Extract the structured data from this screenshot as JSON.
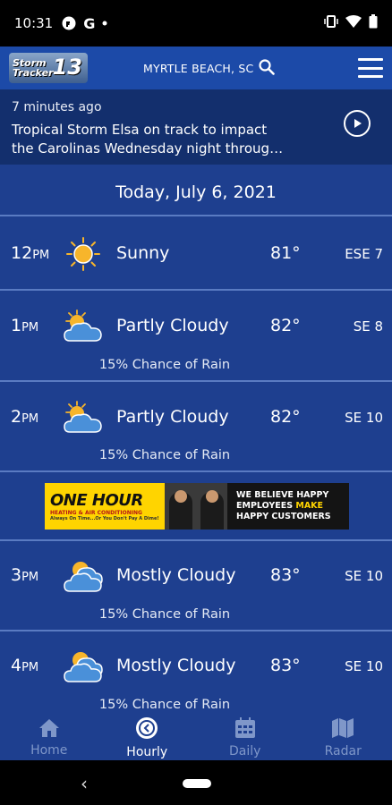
{
  "status_bar": {
    "time": "10:31",
    "icons": [
      "facebook-messenger-icon",
      "google-icon",
      "dot-icon",
      "vibrate-icon",
      "wifi-icon",
      "battery-icon"
    ]
  },
  "header": {
    "logo_text_line1": "Storm",
    "logo_text_line2": "Tracker",
    "logo_number": "13",
    "location": "MYRTLE BEACH, SC"
  },
  "news": {
    "ago": "7 minutes ago",
    "headline_line1": "Tropical Storm Elsa on track to impact",
    "headline_line2": "the Carolinas Wednesday night throug…"
  },
  "date_heading": "Today, July 6, 2021",
  "hours": [
    {
      "hour": "12",
      "ampm": "PM",
      "icon": "sunny-icon",
      "condition": "Sunny",
      "temp": "81°",
      "wind": "ESE 7",
      "rain": ""
    },
    {
      "hour": "1",
      "ampm": "PM",
      "icon": "partly-cloudy-icon",
      "condition": "Partly Cloudy",
      "temp": "82°",
      "wind": "SE 8",
      "rain": "15% Chance of Rain"
    },
    {
      "hour": "2",
      "ampm": "PM",
      "icon": "partly-cloudy-icon",
      "condition": "Partly Cloudy",
      "temp": "82°",
      "wind": "SE 10",
      "rain": "15% Chance of Rain"
    },
    {
      "hour": "3",
      "ampm": "PM",
      "icon": "mostly-cloudy-icon",
      "condition": "Mostly Cloudy",
      "temp": "83°",
      "wind": "SE 10",
      "rain": "15% Chance of Rain"
    },
    {
      "hour": "4",
      "ampm": "PM",
      "icon": "mostly-cloudy-icon",
      "condition": "Mostly Cloudy",
      "temp": "83°",
      "wind": "SE 10",
      "rain": "15% Chance of Rain"
    }
  ],
  "ad": {
    "brand": "ONE HOUR",
    "brand_sub": "HEATING & AIR CONDITIONING",
    "tagline": "Always On Time...Or You Don't Pay A Dime!",
    "line1": "WE BELIEVE HAPPY",
    "line2a": "EMPLOYEES ",
    "line2b": "MAKE",
    "line3": "HAPPY CUSTOMERS"
  },
  "bottom_nav": [
    {
      "label": "Home",
      "icon": "home-icon"
    },
    {
      "label": "Hourly",
      "icon": "clock-icon"
    },
    {
      "label": "Daily",
      "icon": "calendar-icon"
    },
    {
      "label": "Radar",
      "icon": "map-icon"
    }
  ],
  "colors": {
    "background": "#1e3f8f",
    "appbar": "#1c4aa8",
    "news_banner": "#132f6d",
    "divider": "#5a7bc2",
    "sun": "#f7b52b",
    "cloud": "#4a90d9",
    "nav_inactive": "#7f97c9"
  }
}
